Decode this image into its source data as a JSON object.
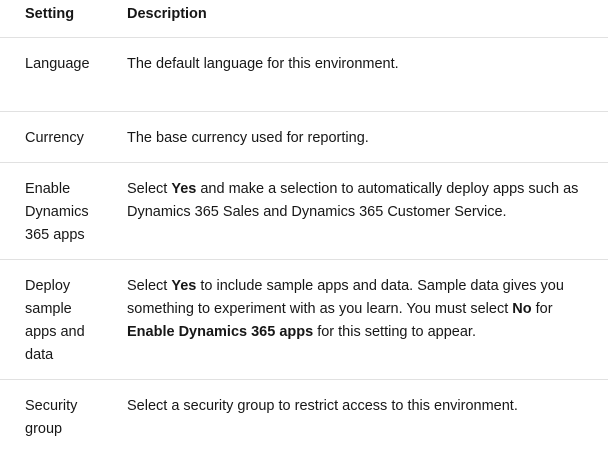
{
  "table": {
    "headers": {
      "setting": "Setting",
      "description": "Description"
    },
    "rows": {
      "language": {
        "setting": "Language",
        "description": "The default language for this environment."
      },
      "currency": {
        "setting": "Currency",
        "description": "The base currency used for reporting."
      },
      "enable_dynamics": {
        "setting_lines": [
          "Enable",
          "Dynamics",
          "365 apps"
        ],
        "desc_parts": [
          "Select ",
          "Yes",
          " and make a selection to automatically deploy apps such as Dynamics 365 Sales and Dynamics 365 Customer Service."
        ]
      },
      "deploy_sample": {
        "setting_lines": [
          "Deploy",
          "sample",
          "apps and",
          "data"
        ],
        "desc_parts": [
          "Select ",
          "Yes",
          " to include sample apps and data. Sample data gives you something to experiment with as you learn. You must select ",
          "No",
          " for ",
          "Enable Dynamics 365 apps",
          " for this setting to appear."
        ]
      },
      "security_group": {
        "setting_lines": [
          "Security",
          "group"
        ],
        "description": "Select a security group to restrict access to this environment."
      }
    }
  }
}
